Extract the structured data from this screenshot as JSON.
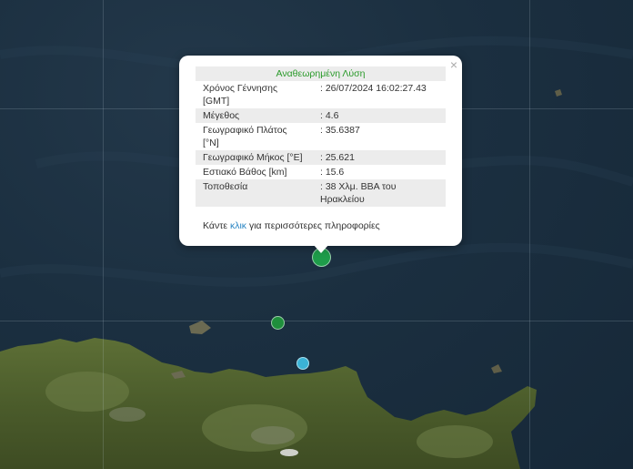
{
  "popup": {
    "title": "Αναθεωρημένη Λύση",
    "close": "×",
    "rows": [
      {
        "label": "Χρόνος Γέννησης [GMT]",
        "value": ": 26/07/2024 16:02:27.43"
      },
      {
        "label": "Μέγεθος",
        "value": ": 4.6"
      },
      {
        "label": "Γεωγραφικό Πλάτος [°N]",
        "value": ": 35.6387"
      },
      {
        "label": "Γεωγραφικό Μήκος [°E]",
        "value": ": 25.621"
      },
      {
        "label": "Εστιακό Βάθος [km]",
        "value": ": 15.6"
      },
      {
        "label": "Τοποθεσία",
        "value": ": 38 Χλμ. ΒΒΑ του Ηρακλείου"
      }
    ],
    "more_prefix": "Κάντε ",
    "more_link": "κλικ",
    "more_suffix": " για περισσότερες πληροφορίες"
  },
  "markers": [
    {
      "name": "selected-earthquake",
      "color": "#1e9c4a"
    },
    {
      "name": "earthquake",
      "color": "#1f8f3c"
    },
    {
      "name": "earthquake",
      "color": "#3bb3d6"
    }
  ],
  "colors": {
    "sea": "#1b2f40",
    "land": "#4d5f2c",
    "title_green": "#2a9a2a",
    "link": "#2a86c4"
  }
}
